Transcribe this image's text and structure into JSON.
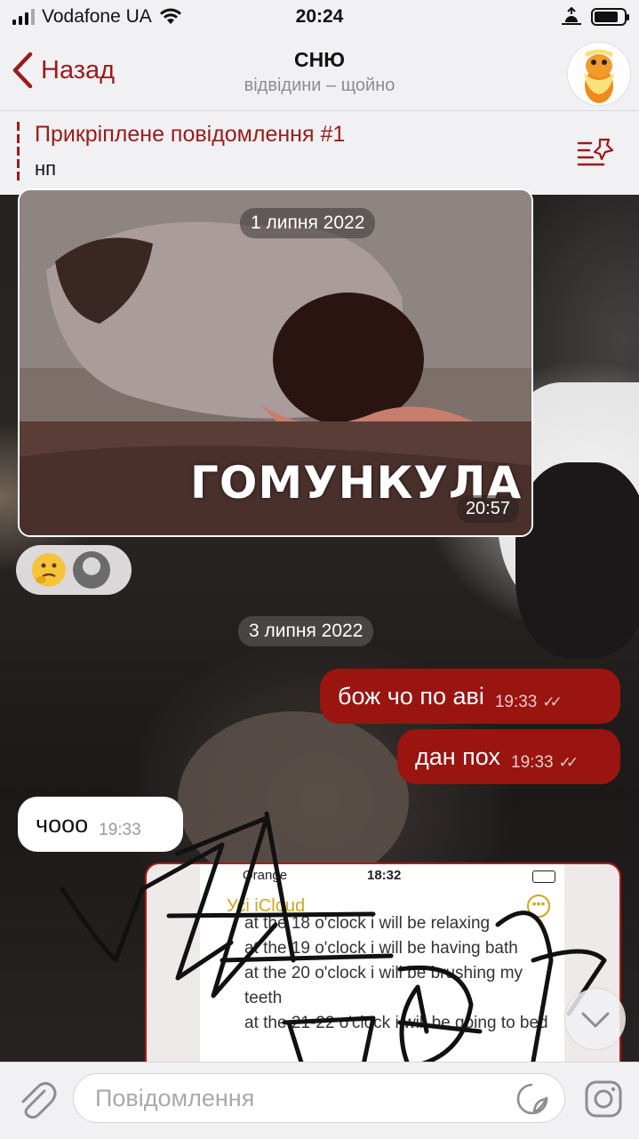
{
  "status_bar": {
    "carrier": "Vodafone UA",
    "time": "20:24"
  },
  "header": {
    "back_label": "Назад",
    "title": "СНЮ",
    "subtitle": "відвідини – щойно"
  },
  "pinned": {
    "title": "Прикріплене повідомлення #1",
    "text": "нп"
  },
  "messages": {
    "image_msg": {
      "date": "1 липня 2022",
      "caption": "ГОМУНКУЛА",
      "time": "20:57"
    },
    "date_separator": "3 липня 2022",
    "out1": {
      "text": "бож чо по аві",
      "time": "19:33"
    },
    "out2": {
      "text": "дан пох",
      "time": "19:33"
    },
    "in1": {
      "text": "чооо",
      "time": "19:33"
    },
    "screenshot_msg": {
      "carrier": "Orange",
      "time": "18:32",
      "note_title": "Усі iCloud",
      "lines": [
        "at the 18 o'clock i will be relaxing",
        "at the 19 o'clock i will be having bath",
        "at the 20 o'clock i will be brushing my",
        "teeth",
        "at the 21-22 o'clock i will be going to bed"
      ]
    }
  },
  "input": {
    "placeholder": "Повідомлення"
  },
  "icons": {
    "back": "chevron-left-icon",
    "pinned_list": "pinned-list-icon",
    "attach": "paperclip-icon",
    "sticker": "sticker-icon",
    "camera": "instagram-camera-icon",
    "scroll": "chevron-down-icon"
  },
  "colors": {
    "accent": "#9b1b1b",
    "outgoing_bubble": "#9a1410",
    "incoming_bubble": "#ffffff",
    "bar_bg": "#f1f0f2"
  }
}
